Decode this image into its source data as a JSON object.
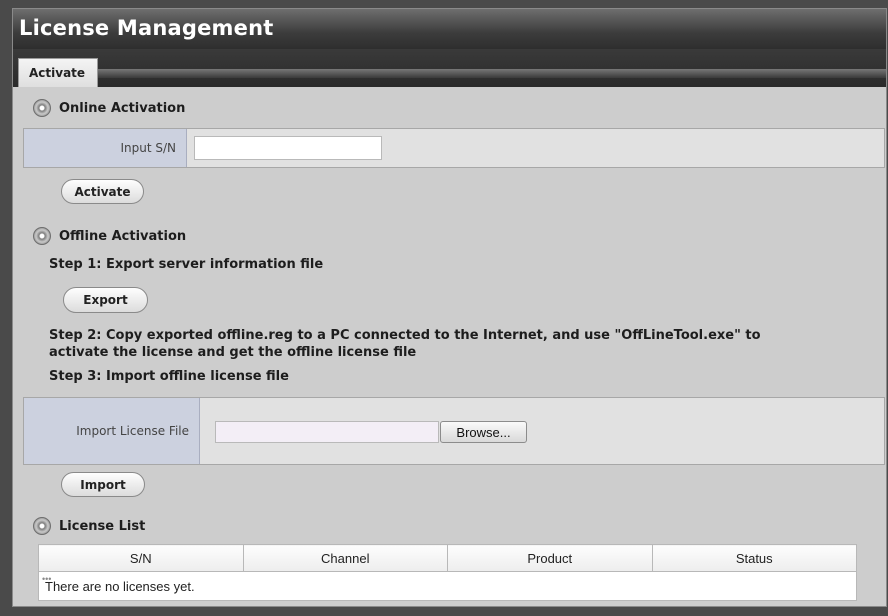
{
  "header": {
    "title": "License Management"
  },
  "tabs": [
    {
      "label": "Activate"
    }
  ],
  "online": {
    "title": "Online Activation",
    "sn_label": "Input S/N",
    "sn_value": "",
    "activate_label": "Activate"
  },
  "offline": {
    "title": "Offline Activation",
    "step1": "Step 1: Export server information file",
    "export_label": "Export",
    "step2_line1": "Step 2: Copy exported offline.reg to a PC connected to the Internet, and use \"OffLineTool.exe\" to",
    "step2_line2": "activate the license and get the offline license file",
    "step3": "Step 3: Import offline license file",
    "import_label_text": "Import License File",
    "file_value": "",
    "browse_label": "Browse...",
    "import_button_label": "Import"
  },
  "license_list": {
    "title": "License List",
    "columns": [
      "S/N",
      "Channel",
      "Product",
      "Status"
    ],
    "empty_message": "There are no licenses yet."
  },
  "icons": {
    "section": "disc-icon",
    "empty_row": "loading-dots-icon"
  }
}
